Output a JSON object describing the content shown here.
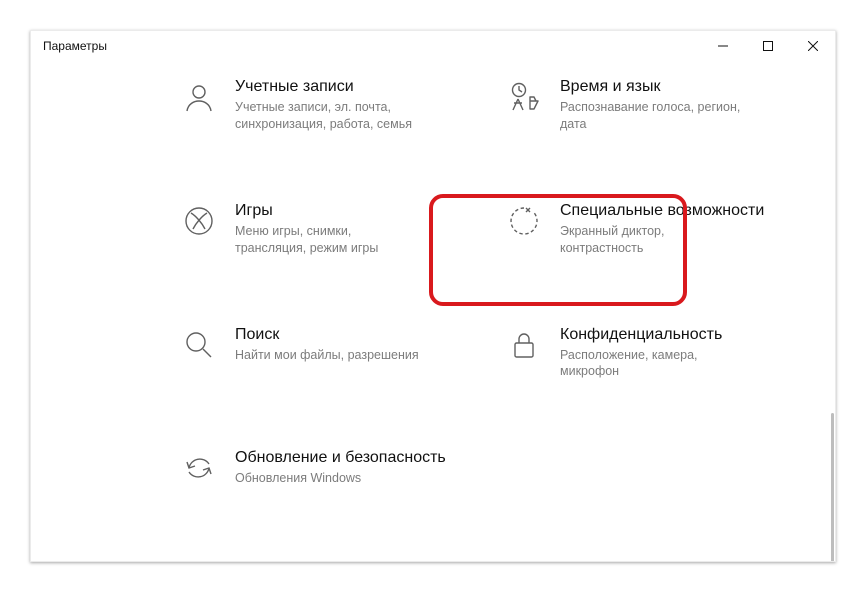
{
  "window": {
    "title": "Параметры"
  },
  "grid": {
    "accounts": {
      "title": "Учетные записи",
      "desc": "Учетные записи, эл. почта, синхронизация, работа, семья"
    },
    "time": {
      "title": "Время и язык",
      "desc": "Распознавание голоса, регион, дата"
    },
    "gaming": {
      "title": "Игры",
      "desc": "Меню игры, снимки, трансляция, режим игры"
    },
    "ease": {
      "title": "Специальные возможности",
      "desc": "Экранный диктор, контрастность"
    },
    "search": {
      "title": "Поиск",
      "desc": "Найти мои файлы, разрешения"
    },
    "privacy": {
      "title": "Конфиденциальность",
      "desc": "Расположение, камера, микрофон"
    },
    "update": {
      "title": "Обновление и безопасность",
      "desc": "Обновления Windows"
    }
  }
}
